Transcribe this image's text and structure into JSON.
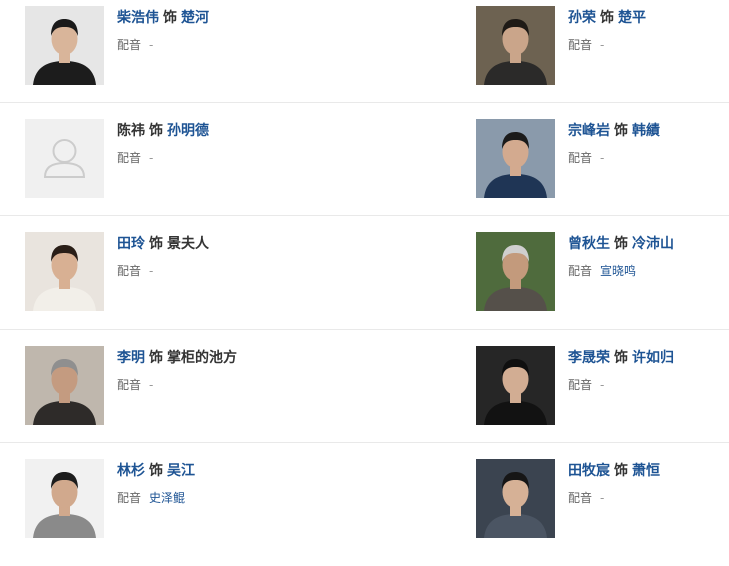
{
  "role_separator": "饰",
  "dub_label": "配音",
  "colors": {
    "link": "#1e5494",
    "text": "#333333",
    "muted": "#999999",
    "divider": "#e9e9e9"
  },
  "cast": [
    {
      "left": {
        "actor": "柴浩伟",
        "actor_link": true,
        "role": "楚河",
        "role_link": true,
        "dub": "-",
        "dub_link": false,
        "photo": "actor-photo",
        "bg": "#e6e6e6",
        "shirt": "#1c1c1c",
        "skin": "#d9b59a",
        "hair": "#1a1a1a"
      },
      "right": {
        "actor": "孙荣",
        "actor_link": true,
        "role": "楚平",
        "role_link": true,
        "dub": "-",
        "dub_link": false,
        "photo": "actor-photo",
        "bg": "#6d6251",
        "shirt": "#2b2a29",
        "skin": "#caa58a",
        "hair": "#1e1a16"
      }
    },
    {
      "left": {
        "actor": "陈祎",
        "actor_link": false,
        "role": "孙明德",
        "role_link": true,
        "dub": "-",
        "dub_link": false,
        "photo": "placeholder-avatar",
        "bg": "#f0f0f0"
      },
      "right": {
        "actor": "宗峰岩",
        "actor_link": true,
        "role": "韩績",
        "role_link": true,
        "dub": "-",
        "dub_link": false,
        "photo": "actor-photo",
        "bg": "#8a9aab",
        "shirt": "#1f3555",
        "skin": "#d3aa8f",
        "hair": "#1b1b1b"
      }
    },
    {
      "left": {
        "actor": "田玲",
        "actor_link": true,
        "role": "景夫人",
        "role_link": false,
        "dub": "-",
        "dub_link": false,
        "photo": "actor-photo",
        "bg": "#e9e4de",
        "shirt": "#f2efe9",
        "skin": "#d8b093",
        "hair": "#2a1e17"
      },
      "right": {
        "actor": "曾秋生",
        "actor_link": true,
        "role": "冷沛山",
        "role_link": true,
        "dub": "宣晓鸣",
        "dub_link": true,
        "photo": "actor-photo",
        "bg": "#4f6b3d",
        "shirt": "#55504a",
        "skin": "#c39a7c",
        "hair": "#cfcfcf"
      }
    },
    {
      "left": {
        "actor": "李明",
        "actor_link": true,
        "role": "掌柜的池方",
        "role_link": false,
        "dub": "-",
        "dub_link": false,
        "photo": "actor-photo",
        "bg": "#bfb7ad",
        "shirt": "#2e2b29",
        "skin": "#c49b80",
        "hair": "#8f8f8f"
      },
      "right": {
        "actor": "李晟荣",
        "actor_link": true,
        "role": "许如归",
        "role_link": true,
        "dub": "-",
        "dub_link": false,
        "photo": "actor-photo",
        "bg": "#262626",
        "shirt": "#121212",
        "skin": "#d2ad93",
        "hair": "#0f0f0f"
      }
    },
    {
      "left": {
        "actor": "林杉",
        "actor_link": true,
        "role": "吴江",
        "role_link": true,
        "dub": "史泽鲲",
        "dub_link": true,
        "photo": "actor-photo",
        "bg": "#f1f1f1",
        "shirt": "#8a8a8a",
        "skin": "#d1a98d",
        "hair": "#1d1d1d"
      },
      "right": {
        "actor": "田牧宸",
        "actor_link": true,
        "role": "萧恒",
        "role_link": true,
        "dub": "-",
        "dub_link": false,
        "photo": "actor-photo",
        "bg": "#3b4450",
        "shirt": "#4b5563",
        "skin": "#d6b196",
        "hair": "#161616"
      }
    }
  ]
}
